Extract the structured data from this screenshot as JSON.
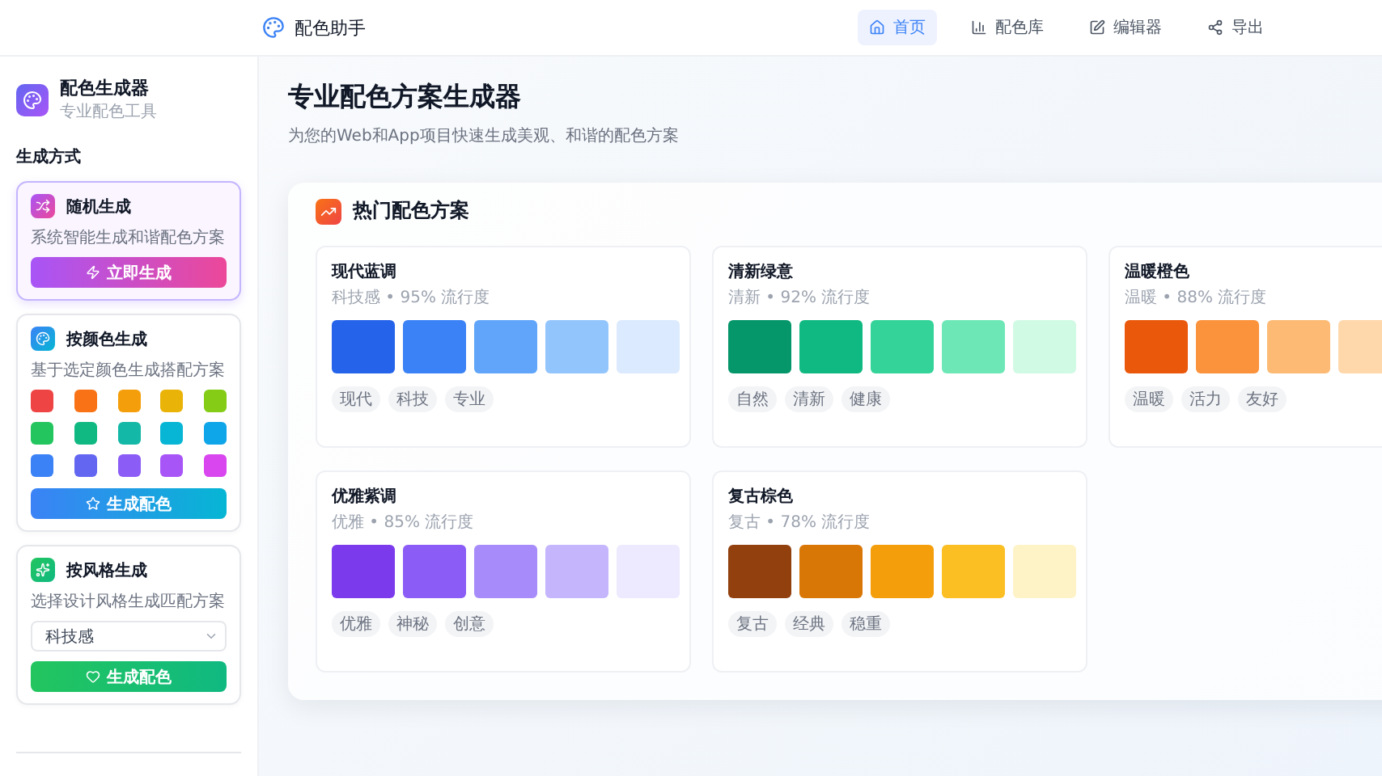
{
  "navbar": {
    "brand": "配色助手",
    "items": [
      {
        "kind": "home",
        "label": "首页",
        "selected": true
      },
      {
        "kind": "library",
        "label": "配色库",
        "selected": false
      },
      {
        "kind": "editor",
        "label": "编辑器",
        "selected": false
      },
      {
        "kind": "export",
        "label": "导出",
        "selected": false
      }
    ]
  },
  "sidebar": {
    "title": "配色生成器",
    "subtitle": "专业配色工具",
    "section_title": "生成方式",
    "methods": [
      {
        "kind": "random",
        "title": "随机生成",
        "description": "系统智能生成和谐配色方案",
        "button": "立即生成",
        "selected": true
      },
      {
        "kind": "color",
        "title": "按颜色生成",
        "description": "基于选定颜色生成搭配方案",
        "button": "生成配色",
        "selected": false,
        "swatches": [
          {
            "color": "#ef4444"
          },
          {
            "color": "#f97316"
          },
          {
            "color": "#f59e0b"
          },
          {
            "color": "#eab308"
          },
          {
            "color": "#84cc16"
          },
          {
            "color": "#22c55e"
          },
          {
            "color": "#10b981"
          },
          {
            "color": "#14b8a6"
          },
          {
            "color": "#06b6d4"
          },
          {
            "color": "#0ea5e9"
          },
          {
            "color": "#3b82f6"
          },
          {
            "color": "#6366f1"
          },
          {
            "color": "#8b5cf6"
          },
          {
            "color": "#a855f7"
          },
          {
            "color": "#d946ef"
          }
        ]
      },
      {
        "kind": "style",
        "title": "按风格生成",
        "description": "选择设计风格生成匹配方案",
        "select_value": "科技感",
        "button": "生成配色",
        "selected": false
      }
    ]
  },
  "main": {
    "title": "专业配色方案生成器",
    "subtitle": "为您的Web和App项目快速生成美观、和谐的配色方案",
    "panel": {
      "title": "热门配色方案",
      "palettes": [
        {
          "name": "现代蓝调",
          "meta": "科技感 • 95% 流行度",
          "colors": [
            {
              "color": "#2563eb"
            },
            {
              "color": "#3b82f6"
            },
            {
              "color": "#60a5fa"
            },
            {
              "color": "#93c5fd"
            },
            {
              "color": "#dbeafe"
            }
          ],
          "tags": [
            "现代",
            "科技",
            "专业"
          ]
        },
        {
          "name": "清新绿意",
          "meta": "清新 • 92% 流行度",
          "colors": [
            {
              "color": "#059669"
            },
            {
              "color": "#10b981"
            },
            {
              "color": "#34d399"
            },
            {
              "color": "#6ee7b7"
            },
            {
              "color": "#d1fae5"
            }
          ],
          "tags": [
            "自然",
            "清新",
            "健康"
          ]
        },
        {
          "name": "温暖橙色",
          "meta": "温暖 • 88% 流行度",
          "colors": [
            {
              "color": "#ea580c"
            },
            {
              "color": "#fb923c"
            },
            {
              "color": "#fdba74"
            },
            {
              "color": "#fed7aa"
            }
          ],
          "tags": [
            "温暖",
            "活力",
            "友好"
          ]
        },
        {
          "name": "优雅紫调",
          "meta": "优雅 • 85% 流行度",
          "colors": [
            {
              "color": "#7c3aed"
            },
            {
              "color": "#8b5cf6"
            },
            {
              "color": "#a78bfa"
            },
            {
              "color": "#c4b5fd"
            },
            {
              "color": "#ede9fe"
            }
          ],
          "tags": [
            "优雅",
            "神秘",
            "创意"
          ]
        },
        {
          "name": "复古棕色",
          "meta": "复古 • 78% 流行度",
          "colors": [
            {
              "color": "#92400e"
            },
            {
              "color": "#d97706"
            },
            {
              "color": "#f59e0b"
            },
            {
              "color": "#fbbf24"
            },
            {
              "color": "#fef3c7"
            }
          ],
          "tags": [
            "复古",
            "经典",
            "稳重"
          ]
        }
      ]
    }
  }
}
